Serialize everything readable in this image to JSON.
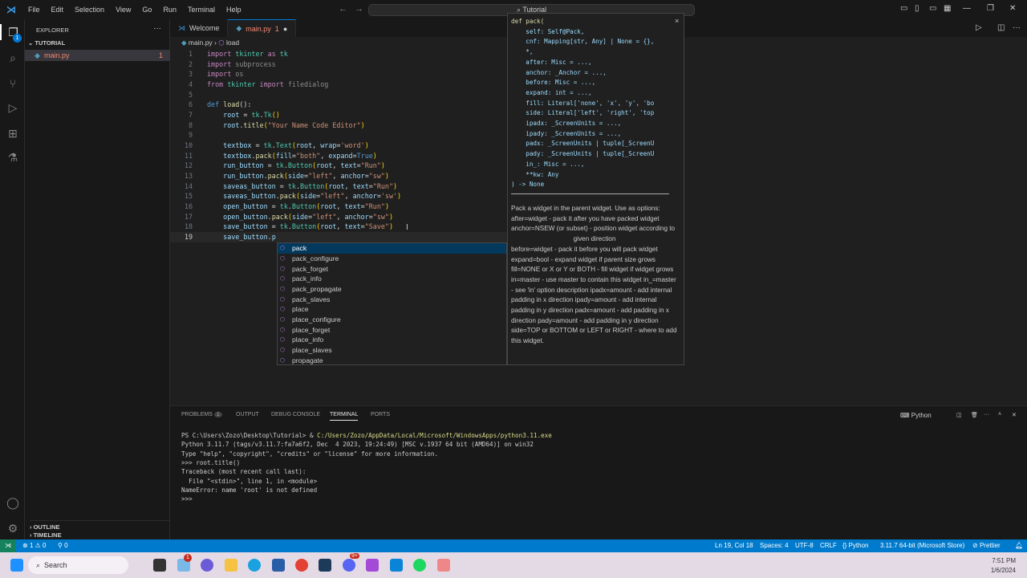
{
  "menu": [
    "File",
    "Edit",
    "Selection",
    "View",
    "Go",
    "Run",
    "Terminal",
    "Help"
  ],
  "search_box": "Tutorial",
  "explorer": {
    "title": "EXPLORER",
    "folder": "TUTORIAL",
    "file": "main.py",
    "file_badge": "1",
    "outline": "OUTLINE",
    "timeline": "TIMELINE",
    "activity_badge": "1"
  },
  "tabs": [
    {
      "label": "Welcome"
    },
    {
      "label": "main.py",
      "badge": "1"
    }
  ],
  "breadcrumb": {
    "file": "main.py",
    "symbol": "load"
  },
  "code": [
    [
      [
        "import ",
        "k"
      ],
      [
        "tkinter",
        "m"
      ],
      [
        " as ",
        "k"
      ],
      [
        "tk",
        "m"
      ]
    ],
    [
      [
        "import ",
        "k"
      ],
      [
        "subprocess",
        "g"
      ]
    ],
    [
      [
        "import ",
        "k"
      ],
      [
        "os",
        "g"
      ]
    ],
    [
      [
        "from ",
        "k"
      ],
      [
        "tkinter",
        "m"
      ],
      [
        " import ",
        "k"
      ],
      [
        "filedialog",
        "g"
      ]
    ],
    [],
    [
      [
        "def ",
        "c"
      ],
      [
        "load",
        "f"
      ],
      [
        "():",
        "p"
      ]
    ],
    [
      [
        "    root",
        "v"
      ],
      [
        " = ",
        "p"
      ],
      [
        "tk",
        "m"
      ],
      [
        ".",
        "p"
      ],
      [
        "Tk",
        "cls"
      ],
      [
        "()",
        "b"
      ]
    ],
    [
      [
        "    root",
        "v"
      ],
      [
        ".",
        "p"
      ],
      [
        "title",
        "f"
      ],
      [
        "(",
        "b"
      ],
      [
        "\"Your Name Code Editor\"",
        "s"
      ],
      [
        ")",
        "b"
      ]
    ],
    [],
    [
      [
        "    textbox",
        "v"
      ],
      [
        " = ",
        "p"
      ],
      [
        "tk",
        "m"
      ],
      [
        ".",
        "p"
      ],
      [
        "Text",
        "cls"
      ],
      [
        "(",
        "b"
      ],
      [
        "root",
        "v"
      ],
      [
        ", ",
        "p"
      ],
      [
        "wrap",
        "v"
      ],
      [
        "=",
        "p"
      ],
      [
        "'word'",
        "s"
      ],
      [
        ")",
        "b"
      ]
    ],
    [
      [
        "    textbox",
        "v"
      ],
      [
        ".",
        "p"
      ],
      [
        "pack",
        "f"
      ],
      [
        "(",
        "b"
      ],
      [
        "fill",
        "v"
      ],
      [
        "=",
        "p"
      ],
      [
        "\"both\"",
        "s"
      ],
      [
        ", ",
        "p"
      ],
      [
        "expand",
        "v"
      ],
      [
        "=",
        "p"
      ],
      [
        "True",
        "c"
      ],
      [
        ")",
        "b"
      ]
    ],
    [
      [
        "    run_button",
        "v"
      ],
      [
        " = ",
        "p"
      ],
      [
        "tk",
        "m"
      ],
      [
        ".",
        "p"
      ],
      [
        "Button",
        "cls"
      ],
      [
        "(",
        "b"
      ],
      [
        "root",
        "v"
      ],
      [
        ", ",
        "p"
      ],
      [
        "text",
        "v"
      ],
      [
        "=",
        "p"
      ],
      [
        "\"Run\"",
        "s"
      ],
      [
        ")",
        "b"
      ]
    ],
    [
      [
        "    run_button",
        "v"
      ],
      [
        ".",
        "p"
      ],
      [
        "pack",
        "f"
      ],
      [
        "(",
        "b"
      ],
      [
        "side",
        "v"
      ],
      [
        "=",
        "p"
      ],
      [
        "\"left\"",
        "s"
      ],
      [
        ", ",
        "p"
      ],
      [
        "anchor",
        "v"
      ],
      [
        "=",
        "p"
      ],
      [
        "\"sw\"",
        "s"
      ],
      [
        ")",
        "b"
      ]
    ],
    [
      [
        "    saveas_button",
        "v"
      ],
      [
        " = ",
        "p"
      ],
      [
        "tk",
        "m"
      ],
      [
        ".",
        "p"
      ],
      [
        "Button",
        "cls"
      ],
      [
        "(",
        "b"
      ],
      [
        "root",
        "v"
      ],
      [
        ", ",
        "p"
      ],
      [
        "text",
        "v"
      ],
      [
        "=",
        "p"
      ],
      [
        "\"Run\"",
        "s"
      ],
      [
        ")",
        "b"
      ]
    ],
    [
      [
        "    saveas_button",
        "v"
      ],
      [
        ".",
        "p"
      ],
      [
        "pack",
        "f"
      ],
      [
        "(",
        "b"
      ],
      [
        "side",
        "v"
      ],
      [
        "=",
        "p"
      ],
      [
        "\"left\"",
        "s"
      ],
      [
        ", ",
        "p"
      ],
      [
        "anchor",
        "v"
      ],
      [
        "=",
        "p"
      ],
      [
        "'sw'",
        "s"
      ],
      [
        ")",
        "b"
      ]
    ],
    [
      [
        "    open_button",
        "v"
      ],
      [
        " = ",
        "p"
      ],
      [
        "tk",
        "m"
      ],
      [
        ".",
        "p"
      ],
      [
        "Button",
        "cls"
      ],
      [
        "(",
        "b"
      ],
      [
        "root",
        "v"
      ],
      [
        ", ",
        "p"
      ],
      [
        "text",
        "v"
      ],
      [
        "=",
        "p"
      ],
      [
        "\"Run\"",
        "s"
      ],
      [
        ")",
        "b"
      ]
    ],
    [
      [
        "    open_button",
        "v"
      ],
      [
        ".",
        "p"
      ],
      [
        "pack",
        "f"
      ],
      [
        "(",
        "b"
      ],
      [
        "side",
        "v"
      ],
      [
        "=",
        "p"
      ],
      [
        "\"left\"",
        "s"
      ],
      [
        ", ",
        "p"
      ],
      [
        "anchor",
        "v"
      ],
      [
        "=",
        "p"
      ],
      [
        "\"sw\"",
        "s"
      ],
      [
        ")",
        "b"
      ]
    ],
    [
      [
        "    save_button",
        "v"
      ],
      [
        " = ",
        "p"
      ],
      [
        "tk",
        "m"
      ],
      [
        ".",
        "p"
      ],
      [
        "Button",
        "cls"
      ],
      [
        "(",
        "b"
      ],
      [
        "root",
        "v"
      ],
      [
        ", ",
        "p"
      ],
      [
        "text",
        "v"
      ],
      [
        "=",
        "p"
      ],
      [
        "\"Save\"",
        "s"
      ],
      [
        ")",
        "b"
      ]
    ],
    [
      [
        "    save_button",
        "v"
      ],
      [
        ".",
        "p"
      ],
      [
        "p",
        "v"
      ]
    ]
  ],
  "suggestions": [
    "pack",
    "pack_configure",
    "pack_forget",
    "pack_info",
    "pack_propagate",
    "pack_slaves",
    "place",
    "place_configure",
    "place_forget",
    "place_info",
    "place_slaves",
    "propagate"
  ],
  "hover": {
    "signature": [
      "def pack(",
      "    self: Self@Pack,",
      "    cnf: Mapping[str, Any] | None = {},",
      "    *,",
      "    after: Misc = ...,",
      "    anchor: _Anchor = ...,",
      "    before: Misc = ...,",
      "    expand: int = ...,",
      "    fill: Literal['none', 'x', 'y', 'bo",
      "    side: Literal['left', 'right', 'top",
      "    ipadx: _ScreenUnits = ...,",
      "    ipady: _ScreenUnits = ...,",
      "    padx: _ScreenUnits | tuple[_ScreenU",
      "    pady: _ScreenUnits | tuple[_ScreenU",
      "    in_: Misc = ...,",
      "    **kw: Any",
      ") -> None"
    ],
    "doc_1": "Pack a widget in the parent widget. Use as options: after=widget - pack it after you have packed widget anchor=NSEW (or subset) - position widget according to",
    "doc_2": "given direction",
    "doc_3": "before=widget - pack it before you will pack widget expand=bool - expand widget if parent size grows fill=NONE or X or Y or BOTH - fill widget if widget grows in=master - use master to contain this widget in_=master - see 'in' option description ipadx=amount - add internal padding in x direction ipady=amount - add internal padding in y direction padx=amount - add padding in x direction pady=amount - add padding in y direction side=TOP or BOTTOM or LEFT or RIGHT - where to add this widget."
  },
  "panel": {
    "tabs": [
      "PROBLEMS",
      "OUTPUT",
      "DEBUG CONSOLE",
      "TERMINAL",
      "PORTS"
    ],
    "problems_count": "1",
    "shell": "Python",
    "terminal": [
      "PS C:\\Users\\Zozo\\Desktop\\Tutorial> & C:/Users/Zozo/AppData/Local/Microsoft/WindowsApps/python3.11.exe",
      "Python 3.11.7 (tags/v3.11.7:fa7a6f2, Dec  4 2023, 19:24:49) [MSC v.1937 64 bit (AMD64)] on win32",
      "Type \"help\", \"copyright\", \"credits\" or \"license\" for more information.",
      ">>> root.title()",
      "Traceback (most recent call last):",
      "  File \"<stdin>\", line 1, in <module>",
      "NameError: name 'root' is not defined",
      ">>>"
    ]
  },
  "status": {
    "errors": "1",
    "warnings": "0",
    "ports": "0",
    "position": "Ln 19, Col 18",
    "spaces": "Spaces: 4",
    "encoding": "UTF-8",
    "eol": "CRLF",
    "language": "Python",
    "interpreter": "3.11.7 64-bit (Microsoft Store)",
    "formatter": "Prettier"
  },
  "taskbar": {
    "search": "Search",
    "time": "7:51 PM",
    "date": "1/6/2024",
    "weather_badge": "1",
    "discord_badge": "9+"
  }
}
